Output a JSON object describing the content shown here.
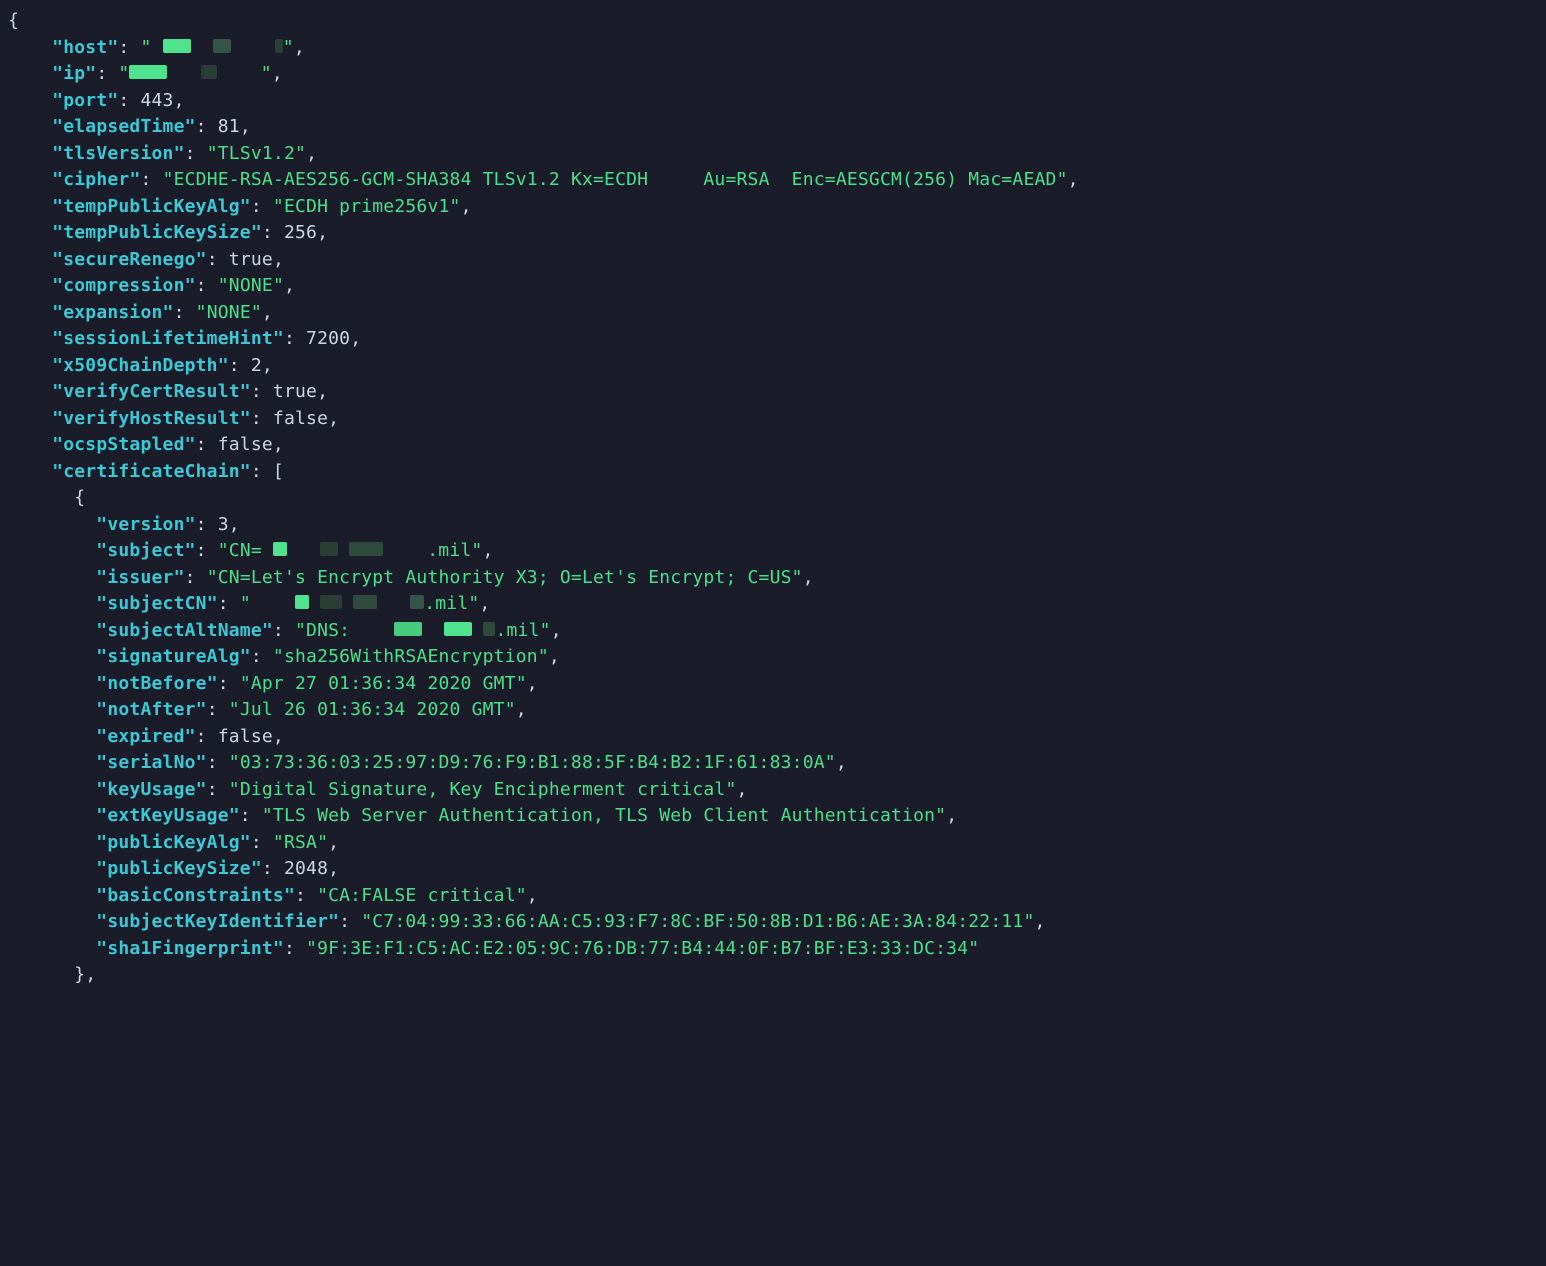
{
  "json": {
    "keys": {
      "host": "host",
      "ip": "ip",
      "port": "port",
      "elapsedTime": "elapsedTime",
      "tlsVersion": "tlsVersion",
      "cipher": "cipher",
      "tempPublicKeyAlg": "tempPublicKeyAlg",
      "tempPublicKeySize": "tempPublicKeySize",
      "secureRenego": "secureRenego",
      "compression": "compression",
      "expansion": "expansion",
      "sessionLifetimeHint": "sessionLifetimeHint",
      "x509ChainDepth": "x509ChainDepth",
      "verifyCertResult": "verifyCertResult",
      "verifyHostResult": "verifyHostResult",
      "ocspStapled": "ocspStapled",
      "certificateChain": "certificateChain",
      "version": "version",
      "subject": "subject",
      "issuer": "issuer",
      "subjectCN": "subjectCN",
      "subjectAltName": "subjectAltName",
      "signatureAlg": "signatureAlg",
      "notBefore": "notBefore",
      "notAfter": "notAfter",
      "expired": "expired",
      "serialNo": "serialNo",
      "keyUsage": "keyUsage",
      "extKeyUsage": "extKeyUsage",
      "publicKeyAlg": "publicKeyAlg",
      "publicKeySize": "publicKeySize",
      "basicConstraints": "basicConstraints",
      "subjectKeyIdentifier": "subjectKeyIdentifier",
      "sha1Fingerprint": "sha1Fingerprint"
    },
    "values": {
      "port": "443",
      "elapsedTime": "81",
      "tlsVersion": "TLSv1.2",
      "cipher": "ECDHE-RSA-AES256-GCM-SHA384 TLSv1.2 Kx=ECDH     Au=RSA  Enc=AESGCM(256) Mac=AEAD",
      "tempPublicKeyAlg": "ECDH prime256v1",
      "tempPublicKeySize": "256",
      "secureRenego": "true",
      "compression": "NONE",
      "expansion": "NONE",
      "sessionLifetimeHint": "7200",
      "x509ChainDepth": "2",
      "verifyCertResult": "true",
      "verifyHostResult": "false",
      "ocspStapled": "false",
      "version": "3",
      "subject_prefix": "CN= ",
      "subject_suffix": ".mil",
      "issuer": "CN=Let's Encrypt Authority X3; O=Let's Encrypt; C=US",
      "subjectCN_suffix": ".mil",
      "subjectAltName_prefix": "DNS:",
      "subjectAltName_suffix": ".mil",
      "signatureAlg": "sha256WithRSAEncryption",
      "notBefore": "Apr 27 01:36:34 2020 GMT",
      "notAfter": "Jul 26 01:36:34 2020 GMT",
      "expired": "false",
      "serialNo": "03:73:36:03:25:97:D9:76:F9:B1:88:5F:B4:B2:1F:61:83:0A",
      "keyUsage": "Digital Signature, Key Encipherment critical",
      "extKeyUsage": "TLS Web Server Authentication, TLS Web Client Authentication",
      "publicKeyAlg": "RSA",
      "publicKeySize": "2048",
      "basicConstraints": "CA:FALSE critical",
      "subjectKeyIdentifier": "C7:04:99:33:66:AA:C5:93:F7:8C:BF:50:8B:D1:B6:AE:3A:84:22:11",
      "sha1Fingerprint": "9F:3E:F1:C5:AC:E2:05:9C:76:DB:77:B4:44:0F:B7:BF:E3:33:DC:34"
    }
  }
}
